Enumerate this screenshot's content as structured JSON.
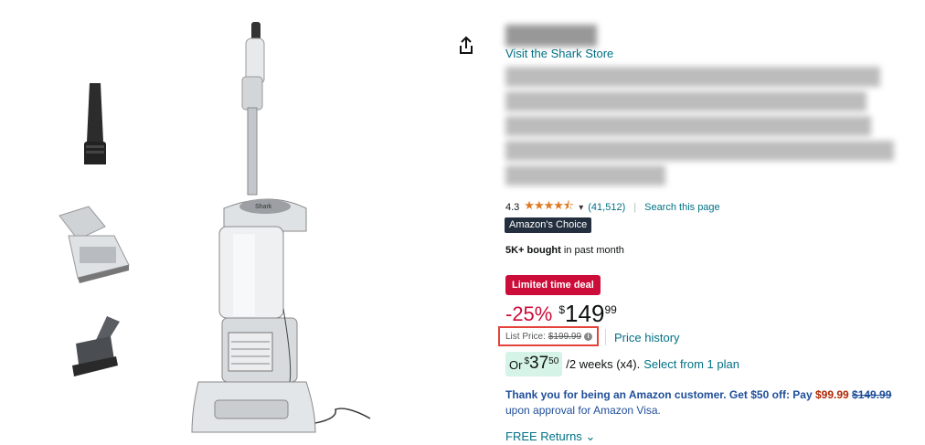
{
  "store": {
    "link": "Visit the Shark Store"
  },
  "rating": {
    "value": "4.3",
    "stars_filled": 4.3,
    "count": "(41,512)",
    "search_link": "Search this page"
  },
  "badge": {
    "choice": "Amazon's Choice"
  },
  "social": {
    "bought_bold": "5K+ bought",
    "bought_rest": " in past month"
  },
  "deal": {
    "label": "Limited time deal"
  },
  "price": {
    "discount": "-25%",
    "currency": "$",
    "whole": "149",
    "fraction": "99",
    "list_label": "List Price:",
    "list_value": "$199.99",
    "history_link": "Price history"
  },
  "plan": {
    "or": "Or",
    "currency": "$",
    "whole": "37",
    "fraction": "50",
    "terms": "/2 weeks (x4).",
    "select_link": "Select from 1 plan"
  },
  "offer": {
    "line1_bold": "Thank you for being an Amazon customer. Get $50 off: Pay",
    "new_price": "$99.99",
    "old_price": "$149.99",
    "line2": "upon approval for Amazon Visa."
  },
  "returns": {
    "label": "FREE Returns"
  },
  "colors": {
    "link": "#007185",
    "deal_red": "#cc0c39",
    "badge_dark": "#232f3e",
    "plan_bg": "#d5f3e7"
  }
}
